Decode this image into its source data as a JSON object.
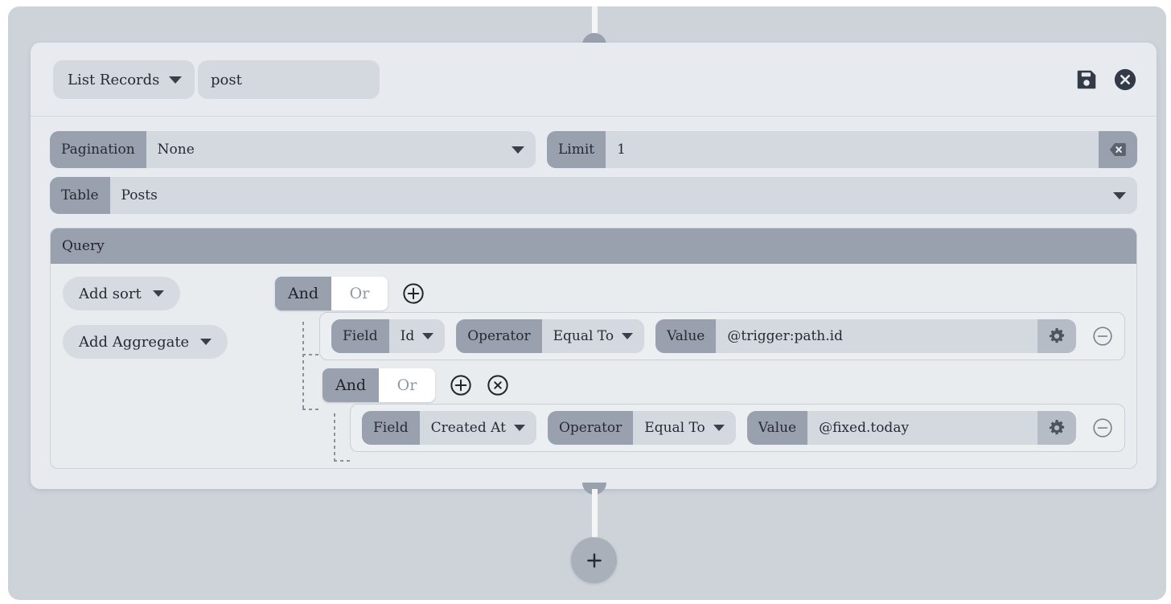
{
  "header": {
    "operation_label": "List Records",
    "operation_caret": "chevron-down-icon",
    "node_name": "post",
    "save_icon": "save-icon",
    "close_icon": "close-circle-icon"
  },
  "pagination": {
    "label": "Pagination",
    "value": "None"
  },
  "limit": {
    "label": "Limit",
    "value": "1",
    "clear_icon": "backspace-clear-icon"
  },
  "table": {
    "label": "Table",
    "value": "Posts"
  },
  "query": {
    "title": "Query",
    "add_sort_label": "Add sort",
    "add_aggregate_label": "Add Aggregate",
    "groups": [
      {
        "and_label": "And",
        "or_label": "Or",
        "selected": "And",
        "add_icon": "plus-circle-icon",
        "remove_icon": null
      },
      {
        "and_label": "And",
        "or_label": "Or",
        "selected": "And",
        "add_icon": "plus-circle-icon",
        "remove_icon": "x-circle-icon"
      }
    ],
    "conditions": [
      {
        "field_label": "Field",
        "field_value": "Id",
        "operator_label": "Operator",
        "operator_value": "Equal To",
        "value_label": "Value",
        "value_value": "@trigger:path.id",
        "settings_icon": "gear-icon",
        "remove_icon": "minus-circle-icon"
      },
      {
        "field_label": "Field",
        "field_value": "Created At",
        "operator_label": "Operator",
        "operator_value": "Equal To",
        "value_label": "Value",
        "value_value": "@fixed.today",
        "settings_icon": "gear-icon",
        "remove_icon": "minus-circle-icon"
      }
    ]
  },
  "flow": {
    "add_step_icon": "plus-icon"
  },
  "colors": {
    "canvas": "#ced3da",
    "card": "#e7eaee",
    "chip": "#9aa1ae",
    "field": "#d4d9df",
    "ink": "#262b33"
  }
}
